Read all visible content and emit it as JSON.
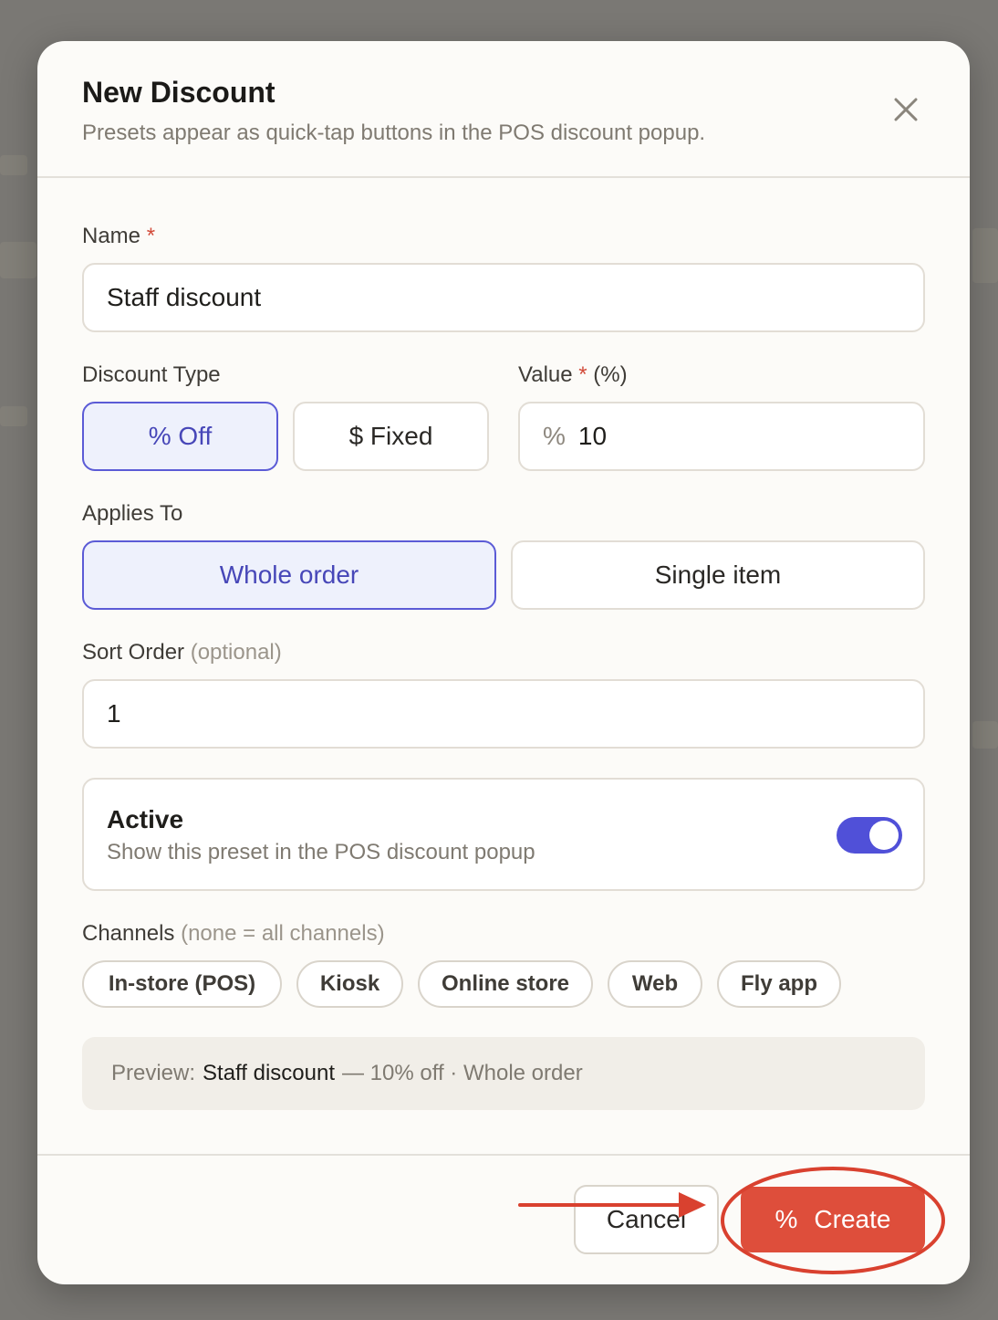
{
  "dialog": {
    "title": "New Discount",
    "subtitle": "Presets appear as quick-tap buttons in the POS discount popup."
  },
  "name_field": {
    "label": "Name",
    "required_mark": "*",
    "value": "Staff discount"
  },
  "discount_type": {
    "label": "Discount Type",
    "options": [
      "% Off",
      "$ Fixed"
    ],
    "selected": "% Off"
  },
  "value_field": {
    "label": "Value",
    "required_mark": "*",
    "unit_hint": "(%)",
    "prefix": "%",
    "value": "10"
  },
  "applies_to": {
    "label": "Applies To",
    "options": [
      "Whole order",
      "Single item"
    ],
    "selected": "Whole order"
  },
  "sort_order": {
    "label": "Sort Order",
    "hint": "(optional)",
    "value": "1"
  },
  "active": {
    "title": "Active",
    "description": "Show this preset in the POS discount popup",
    "enabled": true,
    "accent": "#5050d8"
  },
  "channels": {
    "label": "Channels",
    "hint": "(none = all channels)",
    "items": [
      "In-store (POS)",
      "Kiosk",
      "Online store",
      "Web",
      "Fly app"
    ]
  },
  "preview": {
    "prefix": "Preview:",
    "name": "Staff discount",
    "details": "— 10% off · Whole order"
  },
  "footer": {
    "cancel_label": "Cancel",
    "create_label": "Create",
    "create_icon": "%",
    "create_color": "#de4e3b"
  },
  "annotation_color": "#d9412f"
}
